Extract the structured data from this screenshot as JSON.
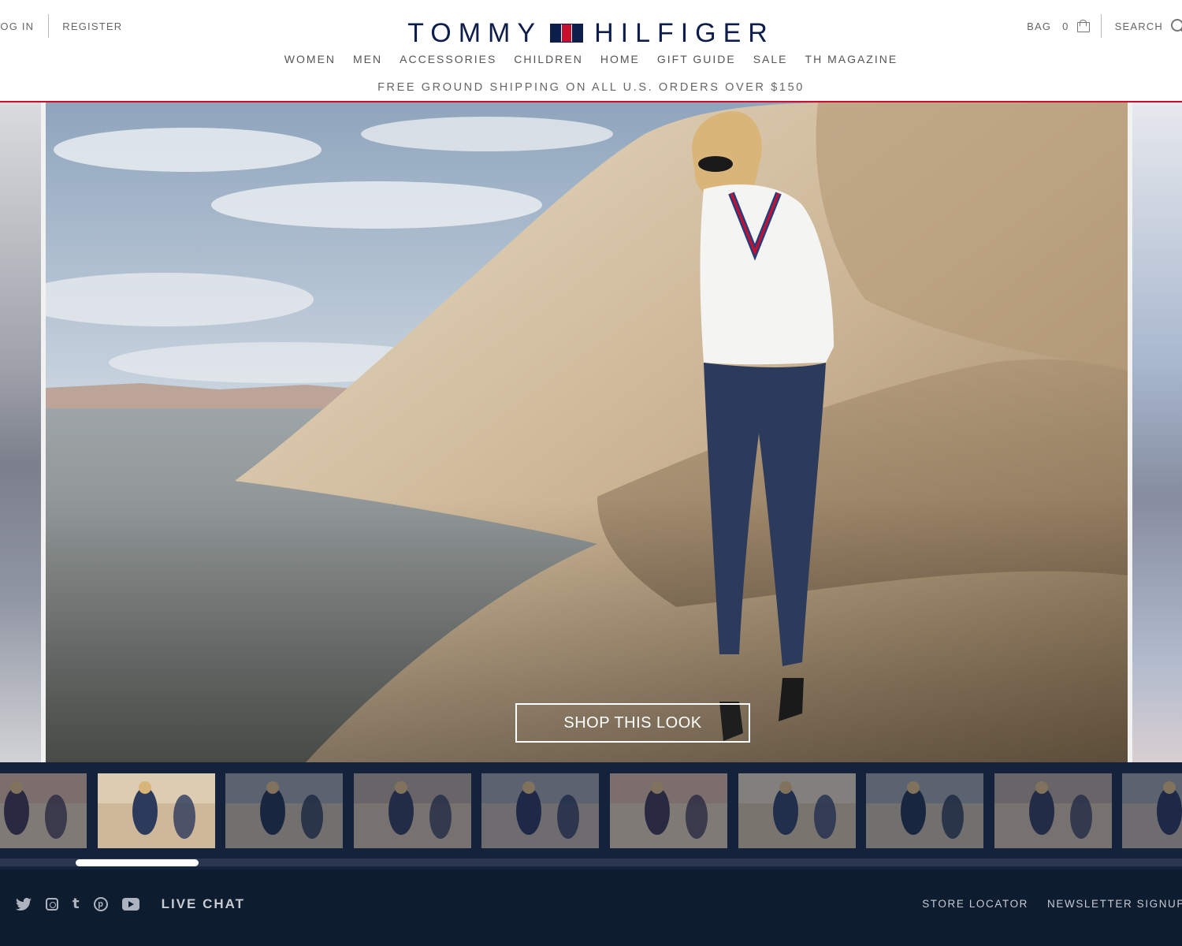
{
  "header": {
    "login": "LOG IN",
    "register": "REGISTER",
    "bag_label": "BAG",
    "bag_count": "0",
    "search_label": "SEARCH",
    "logo_left": "TOMMY",
    "logo_right": "HILFIGER"
  },
  "nav": [
    "WOMEN",
    "MEN",
    "ACCESSORIES",
    "CHILDREN",
    "HOME",
    "GIFT GUIDE",
    "SALE",
    "TH MAGAZINE"
  ],
  "promo": "FREE GROUND SHIPPING ON ALL U.S. ORDERS OVER $150",
  "hero": {
    "cta": "SHOP THIS LOOK"
  },
  "thumbnails": {
    "count": 10,
    "active_index": 1
  },
  "footer": {
    "social_icons": [
      "twitter-icon",
      "instagram-icon",
      "tumblr-icon",
      "pinterest-icon",
      "youtube-icon"
    ],
    "live_chat": "LIVE CHAT",
    "links": [
      "STORE LOCATOR",
      "NEWSLETTER SIGNUP"
    ]
  },
  "colors": {
    "brand_navy": "#0d1e4a",
    "brand_red": "#c8102e",
    "footer_bg": "#0e1c30"
  }
}
